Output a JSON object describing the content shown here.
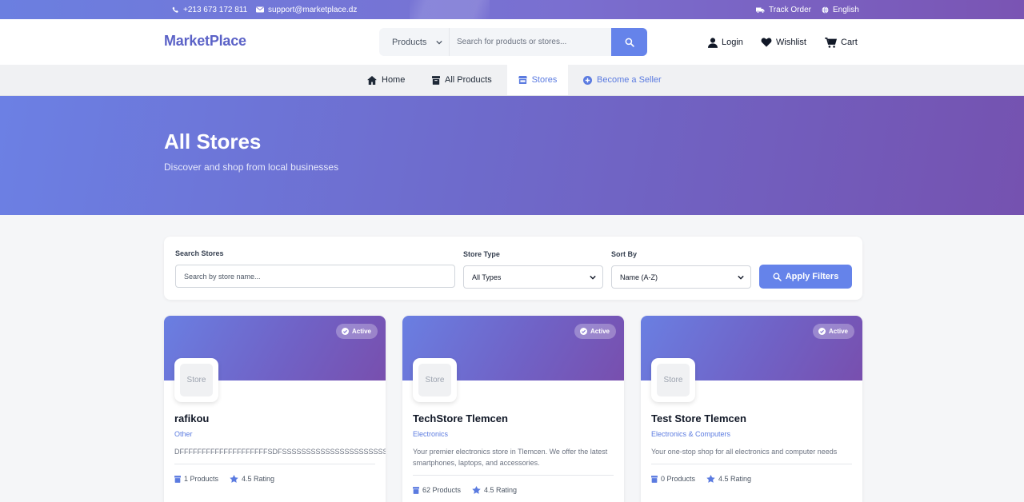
{
  "topbar": {
    "phone": "+213 673 172 811",
    "email": "support@marketplace.dz",
    "track_order": "Track Order",
    "language": "English"
  },
  "header": {
    "logo": "MarketPlace",
    "category": "Products",
    "search_placeholder": "Search for products or stores...",
    "login": "Login",
    "wishlist": "Wishlist",
    "cart": "Cart"
  },
  "nav": {
    "home": "Home",
    "all_products": "All Products",
    "stores": "Stores",
    "become_seller": "Become a Seller"
  },
  "hero": {
    "title": "All Stores",
    "subtitle": "Discover and shop from local businesses"
  },
  "filters": {
    "search_label": "Search Stores",
    "search_placeholder": "Search by store name...",
    "type_label": "Store Type",
    "type_value": "All Types",
    "sort_label": "Sort By",
    "sort_value": "Name (A-Z)",
    "apply": "Apply Filters"
  },
  "stores": [
    {
      "status": "Active",
      "logo_text": "Store",
      "name": "rafikou",
      "type": "Other",
      "description": "DFFFFFFFFFFFFFFFFFFFFSDFSSSSSSSSSSSSSSSSSSSSSSSSSSSSSSSSS",
      "products": "1 Products",
      "rating": "4.5 Rating"
    },
    {
      "status": "Active",
      "logo_text": "Store",
      "name": "TechStore Tlemcen",
      "type": "Electronics",
      "description": "Your premier electronics store in Tlemcen. We offer the latest smartphones, laptops, and accessories.",
      "products": "62 Products",
      "rating": "4.5 Rating"
    },
    {
      "status": "Active",
      "logo_text": "Store",
      "name": "Test Store Tlemcen",
      "type": "Electronics & Computers",
      "description": "Your one-stop shop for all electronics and computer needs",
      "products": "0 Products",
      "rating": "4.5 Rating"
    }
  ],
  "colors": {
    "accent": "#6583ea",
    "brand": "#5b62c7",
    "gradient_start": "#6c80e4",
    "gradient_end": "#7552b0"
  }
}
